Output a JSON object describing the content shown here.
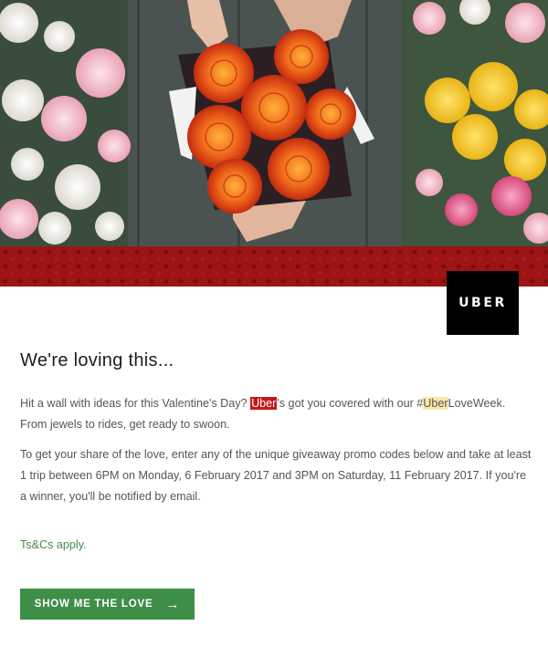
{
  "brand": {
    "logo_text": "UBER",
    "accent_red": "#c6191b",
    "band_red": "#9d1414",
    "cta_green": "#3e8e48"
  },
  "hero": {
    "description_icon": "rose-bouquet-image"
  },
  "heading": "We're loving this...",
  "paragraph1": {
    "pre": "Hit a wall with ideas for this Valentine's Day? ",
    "brand": "Uber",
    "mid": "'s got you covered with our #",
    "hashtag_highlight": "Uber",
    "post": "LoveWeek. From jewels to rides, get ready to swoon."
  },
  "paragraph2": "To get your share of the love, enter any of the unique giveaway promo codes below and take at least 1 trip between 6PM on Monday, 6 February 2017 and 3PM on Saturday, 11 February 2017. If you're a winner, you'll be notified by email.",
  "terms_link": "Ts&Cs apply.",
  "cta": {
    "label": "SHOW ME THE LOVE",
    "icon": "arrow-right-icon",
    "arrow_glyph": "→"
  }
}
